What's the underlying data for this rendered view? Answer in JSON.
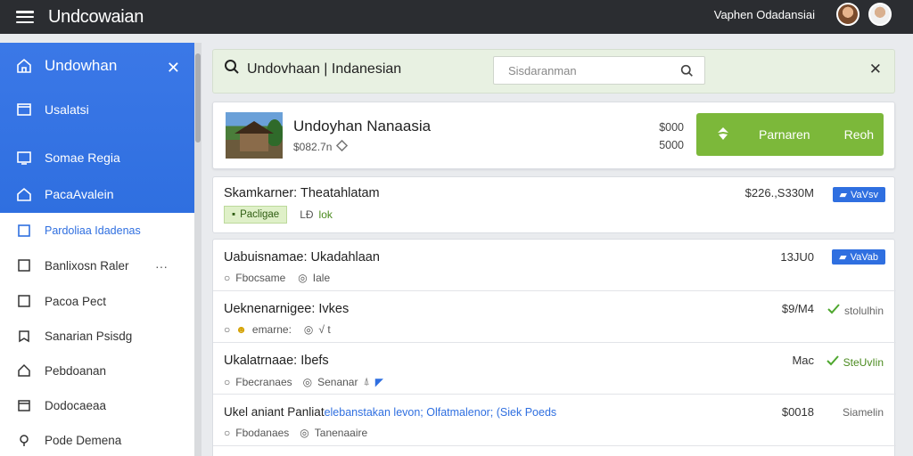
{
  "app": {
    "title": "Undcowaian",
    "user_name": "Vaphen Odadansiai"
  },
  "sidebar": {
    "header": "Undowhan",
    "items": [
      {
        "label": "Usalatsi",
        "icon": "card-icon"
      },
      {
        "label": "Somae Regia",
        "icon": "monitor-icon"
      },
      {
        "label": "PacaAvalein",
        "icon": "home-icon"
      },
      {
        "label": "Pardoliaa Idadenas",
        "icon": "square-icon"
      },
      {
        "label": "Banlixosn Raler",
        "icon": "square-icon",
        "more": "···"
      },
      {
        "label": "Pacoa Pect",
        "icon": "square-icon"
      },
      {
        "label": "Sanarian Psisdg",
        "icon": "bookmark-icon"
      },
      {
        "label": "Pebdoanan",
        "icon": "home-icon"
      },
      {
        "label": "Dodocaeaa",
        "icon": "calendar-icon"
      },
      {
        "label": "Pode Demena",
        "icon": "pin-icon"
      }
    ]
  },
  "search": {
    "query": "Undovhaan | Indanesian",
    "placeholder": "Sisdaranman"
  },
  "product": {
    "title": "Undoyhan Nanaasia",
    "sub": "$082.7n",
    "price1": "$000",
    "price2": "5000",
    "cta_label1": "Parnaren",
    "cta_label2": "Reoh"
  },
  "listings": [
    {
      "title": "Skamkarner: Theatahlatam",
      "tag": "Pacligae",
      "meta_right": "LĐ",
      "meta_extra": "lok",
      "price": "$226.,S330M",
      "badge": "VaVsv"
    },
    {
      "title": "Uabuisnamae: Ukadahlaan",
      "meta1": "Fbocsame",
      "meta2": "Iale",
      "price": "13JU0",
      "badge": "VaVab"
    },
    {
      "title": "Ueknenarnigee: Ivkes",
      "meta1": "emarne:",
      "meta2": "√ t",
      "price": "$9/M4",
      "status": "stolulhin"
    },
    {
      "title": "Ukalatrnaae: Ibefs",
      "meta1": "Fbecranaes",
      "meta2": "Senanar",
      "price": "Mac",
      "status": "SteUvIin"
    },
    {
      "title_a": "Ukel aniant Panliat",
      "title_b": "elebanstakan levon; Olfatmalenor; (Siek Poeds",
      "meta1": "Fbodanaes",
      "meta2": "Tanenaaire",
      "price": "$0018",
      "status": "Siamelin"
    }
  ]
}
